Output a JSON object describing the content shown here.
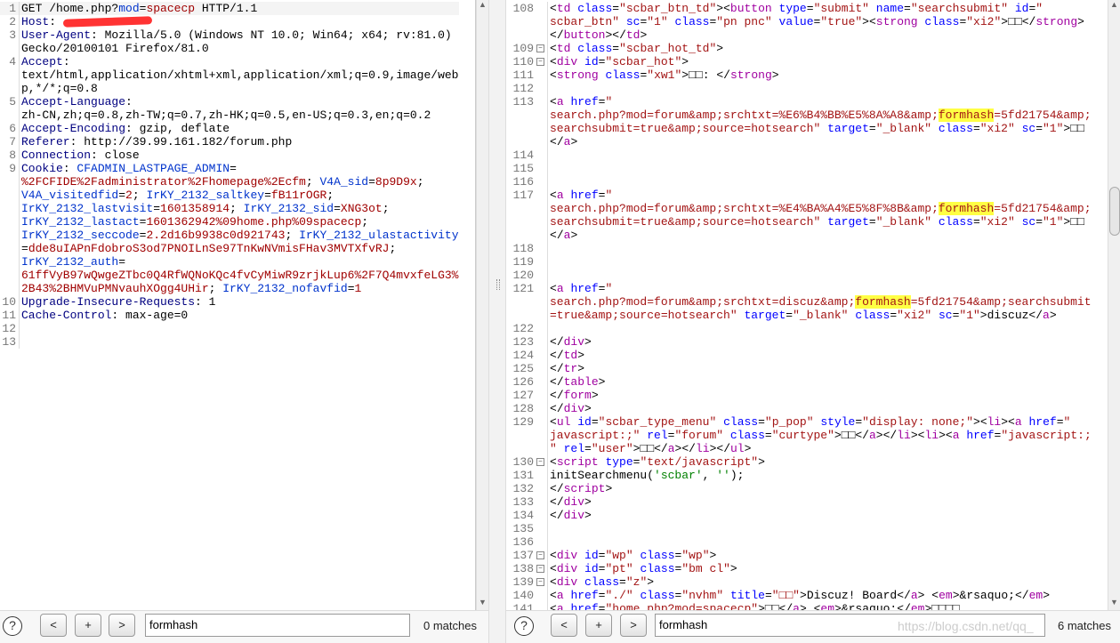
{
  "request": {
    "lines": [
      {
        "n": "1",
        "segs": [
          [
            "p",
            "GET /home.php?"
          ],
          [
            "ck",
            "mod"
          ],
          [
            "p",
            "="
          ],
          [
            "cv",
            "spacecp"
          ],
          [
            "p",
            " HTTP/1.1"
          ]
        ]
      },
      {
        "n": "2",
        "segs": [
          [
            "hn",
            "Host"
          ],
          [
            "p",
            ": "
          ],
          [
            "redact",
            ""
          ]
        ]
      },
      {
        "n": "3",
        "segs": [
          [
            "hn",
            "User-Agent"
          ],
          [
            "p",
            ": Mozilla/5.0 (Windows NT 10.0; Win64; x64; rv:81.0)\nGecko/20100101 Firefox/81.0"
          ]
        ]
      },
      {
        "n": "4",
        "segs": [
          [
            "hn",
            "Accept"
          ],
          [
            "p",
            ":\ntext/html,application/xhtml+xml,application/xml;q=0.9,image/web\np,*/*;q=0.8"
          ]
        ]
      },
      {
        "n": "5",
        "segs": [
          [
            "hn",
            "Accept-Language"
          ],
          [
            "p",
            ":\nzh-CN,zh;q=0.8,zh-TW;q=0.7,zh-HK;q=0.5,en-US;q=0.3,en;q=0.2"
          ]
        ]
      },
      {
        "n": "6",
        "segs": [
          [
            "hn",
            "Accept-Encoding"
          ],
          [
            "p",
            ": gzip, deflate"
          ]
        ]
      },
      {
        "n": "7",
        "segs": [
          [
            "hn",
            "Referer"
          ],
          [
            "p",
            ": http://39.99.161.182/forum.php"
          ]
        ]
      },
      {
        "n": "8",
        "segs": [
          [
            "hn",
            "Connection"
          ],
          [
            "p",
            ": close"
          ]
        ]
      },
      {
        "n": "9",
        "segs": [
          [
            "hn",
            "Cookie"
          ],
          [
            "p",
            ": "
          ],
          [
            "ck",
            "CFADMIN_LASTPAGE_ADMIN"
          ],
          [
            "p",
            "=\n"
          ],
          [
            "cv",
            "%2FCFIDE%2Fadministrator%2Fhomepage%2Ecfm"
          ],
          [
            "p",
            "; "
          ],
          [
            "ck",
            "V4A_sid"
          ],
          [
            "p",
            "="
          ],
          [
            "cv",
            "8p9D9x"
          ],
          [
            "p",
            ";\n"
          ],
          [
            "ck",
            "V4A_visitedfid"
          ],
          [
            "p",
            "="
          ],
          [
            "cv",
            "2"
          ],
          [
            "p",
            "; "
          ],
          [
            "ck",
            "IrKY_2132_saltkey"
          ],
          [
            "p",
            "="
          ],
          [
            "cv",
            "fB11rOGR"
          ],
          [
            "p",
            ";\n"
          ],
          [
            "ck",
            "IrKY_2132_lastvisit"
          ],
          [
            "p",
            "="
          ],
          [
            "cv",
            "1601358914"
          ],
          [
            "p",
            "; "
          ],
          [
            "ck",
            "IrKY_2132_sid"
          ],
          [
            "p",
            "="
          ],
          [
            "cv",
            "XNG3ot"
          ],
          [
            "p",
            ";\n"
          ],
          [
            "ck",
            "IrKY_2132_lastact"
          ],
          [
            "p",
            "="
          ],
          [
            "cv",
            "1601362942%09home.php%09spacecp"
          ],
          [
            "p",
            ";\n"
          ],
          [
            "ck",
            "IrKY_2132_seccode"
          ],
          [
            "p",
            "="
          ],
          [
            "cv",
            "2.2d16b9938c0d921743"
          ],
          [
            "p",
            "; "
          ],
          [
            "ck",
            "IrKY_2132_ulastactivity"
          ],
          [
            "p",
            "\n="
          ],
          [
            "cv",
            "dde8uIAPnFdobroS3od7PNOILnSe97TnKwNVmisFHav3MVTXfvRJ"
          ],
          [
            "p",
            ";\n"
          ],
          [
            "ck",
            "IrKY_2132_auth"
          ],
          [
            "p",
            "=\n"
          ],
          [
            "cv",
            "61ffVyB97wQwgeZTbc0Q4RfWQNoKQc4fvCyMiwR9zrjkLup6%2F7Q4mvxfeLG3%\n2B43%2BHMVuPMNvauhXOgg4UHir"
          ],
          [
            "p",
            "; "
          ],
          [
            "ck",
            "IrKY_2132_nofavfid"
          ],
          [
            "p",
            "="
          ],
          [
            "cv",
            "1"
          ]
        ]
      },
      {
        "n": "10",
        "segs": [
          [
            "hn",
            "Upgrade-Insecure-Requests"
          ],
          [
            "p",
            ": 1"
          ]
        ]
      },
      {
        "n": "11",
        "segs": [
          [
            "hn",
            "Cache-Control"
          ],
          [
            "p",
            ": max-age=0"
          ]
        ]
      },
      {
        "n": "12",
        "segs": []
      },
      {
        "n": "13",
        "segs": []
      }
    ],
    "search": {
      "value": "formhash",
      "matches": "0 matches"
    }
  },
  "response": {
    "highlight_term": "formhash",
    "lines": [
      {
        "n": "108",
        "fold": false,
        "text": "<td class=\"scbar_btn_td\"><button type=\"submit\" name=\"searchsubmit\" id=\"\nscbar_btn\" sc=\"1\" class=\"pn pnc\" value=\"true\"><strong class=\"xi2\">□□</strong>\n</button></td>"
      },
      {
        "n": "109",
        "fold": true,
        "text": "<td class=\"scbar_hot_td\">"
      },
      {
        "n": "110",
        "fold": true,
        "text": "<div id=\"scbar_hot\">"
      },
      {
        "n": "111",
        "fold": false,
        "text": "<strong class=\"xw1\">□□: </strong>"
      },
      {
        "n": "112",
        "fold": false,
        "text": ""
      },
      {
        "n": "113",
        "fold": false,
        "text": "<a href=\"\nsearch.php?mod=forum&amp;srchtxt=%E6%B4%BB%E5%8A%A8&amp;formhash=5fd21754&amp;\nsearchsubmit=true&amp;source=hotsearch\" target=\"_blank\" class=\"xi2\" sc=\"1\">□□\n</a>"
      },
      {
        "n": "114",
        "fold": false,
        "text": ""
      },
      {
        "n": "115",
        "fold": false,
        "text": ""
      },
      {
        "n": "116",
        "fold": false,
        "text": ""
      },
      {
        "n": "117",
        "fold": false,
        "text": "<a href=\"\nsearch.php?mod=forum&amp;srchtxt=%E4%BA%A4%E5%8F%8B&amp;formhash=5fd21754&amp;\nsearchsubmit=true&amp;source=hotsearch\" target=\"_blank\" class=\"xi2\" sc=\"1\">□□\n</a>"
      },
      {
        "n": "118",
        "fold": false,
        "text": ""
      },
      {
        "n": "119",
        "fold": false,
        "text": ""
      },
      {
        "n": "120",
        "fold": false,
        "text": ""
      },
      {
        "n": "121",
        "fold": false,
        "text": "<a href=\"\nsearch.php?mod=forum&amp;srchtxt=discuz&amp;formhash=5fd21754&amp;searchsubmit\n=true&amp;source=hotsearch\" target=\"_blank\" class=\"xi2\" sc=\"1\">discuz</a>"
      },
      {
        "n": "122",
        "fold": false,
        "text": ""
      },
      {
        "n": "123",
        "fold": false,
        "text": "</div>"
      },
      {
        "n": "124",
        "fold": false,
        "text": "</td>"
      },
      {
        "n": "125",
        "fold": false,
        "text": "</tr>"
      },
      {
        "n": "126",
        "fold": false,
        "text": "</table>"
      },
      {
        "n": "127",
        "fold": false,
        "text": "</form>"
      },
      {
        "n": "128",
        "fold": false,
        "text": "</div>"
      },
      {
        "n": "129",
        "fold": false,
        "text": "<ul id=\"scbar_type_menu\" class=\"p_pop\" style=\"display: none;\"><li><a href=\"\njavascript:;\" rel=\"forum\" class=\"curtype\">□□</a></li><li><a href=\"javascript:;\n\" rel=\"user\">□□</a></li></ul>"
      },
      {
        "n": "130",
        "fold": true,
        "text": "<script type=\"text/javascript\">"
      },
      {
        "n": "131",
        "fold": false,
        "text": "initSearchmenu('scbar', '');"
      },
      {
        "n": "132",
        "fold": false,
        "text": "</script>"
      },
      {
        "n": "133",
        "fold": false,
        "text": "</div>"
      },
      {
        "n": "134",
        "fold": false,
        "text": "</div>"
      },
      {
        "n": "135",
        "fold": false,
        "text": ""
      },
      {
        "n": "136",
        "fold": false,
        "text": ""
      },
      {
        "n": "137",
        "fold": true,
        "text": "<div id=\"wp\" class=\"wp\">"
      },
      {
        "n": "138",
        "fold": true,
        "text": "<div id=\"pt\" class=\"bm cl\">"
      },
      {
        "n": "139",
        "fold": true,
        "text": "<div class=\"z\">"
      },
      {
        "n": "140",
        "fold": false,
        "text": "<a href=\"./\" class=\"nvhm\" title=\"□□\">Discuz! Board</a> <em>&rsaquo;</em>"
      },
      {
        "n": "141",
        "fold": false,
        "text": "<a href=\"home.php?mod=spacecp\">□□</a> <em>&rsaquo;</em>□□□□"
      }
    ],
    "search": {
      "value": "formhash",
      "matches": "6 matches"
    }
  },
  "controls": {
    "help": "?",
    "prev": "<",
    "add": "+",
    "next": ">"
  },
  "watermark": "https://blog.csdn.net/qq_"
}
